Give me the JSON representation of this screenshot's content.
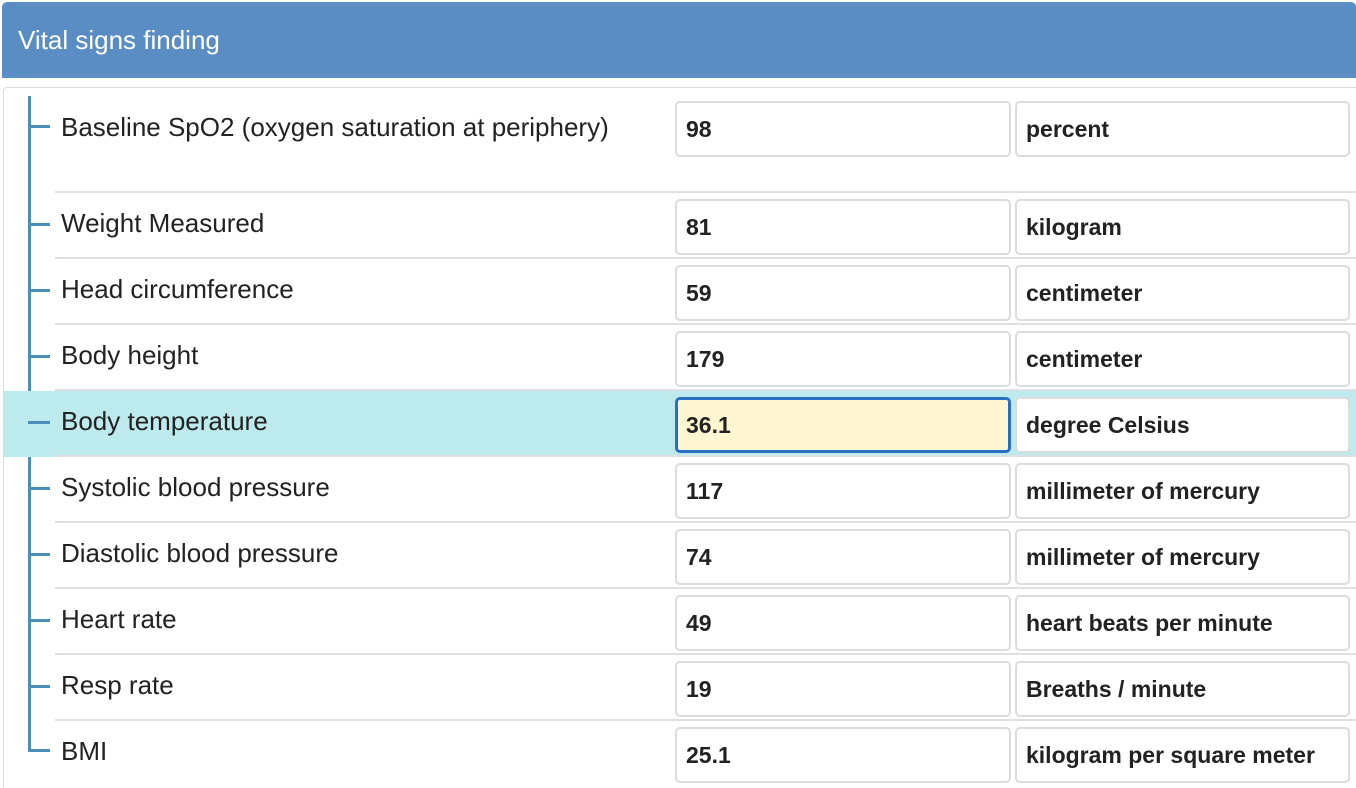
{
  "header": {
    "title": "Vital signs finding"
  },
  "rows": [
    {
      "label": "Baseline SpO2 (oxygen saturation at periphery)",
      "value": "98",
      "unit": "percent"
    },
    {
      "label": "Weight Measured",
      "value": "81",
      "unit": "kilogram"
    },
    {
      "label": "Head circumference",
      "value": "59",
      "unit": "centimeter"
    },
    {
      "label": "Body height",
      "value": "179",
      "unit": "centimeter"
    },
    {
      "label": "Body temperature",
      "value": "36.1",
      "unit": "degree Celsius"
    },
    {
      "label": "Systolic blood pressure",
      "value": "117",
      "unit": "millimeter of mercury"
    },
    {
      "label": "Diastolic blood pressure",
      "value": "74",
      "unit": "millimeter of mercury"
    },
    {
      "label": "Heart rate",
      "value": "49",
      "unit": "heart beats per minute"
    },
    {
      "label": "Resp rate",
      "value": "19",
      "unit": "Breaths / minute"
    },
    {
      "label": "BMI",
      "value": "25.1",
      "unit": "kilogram per square meter"
    }
  ],
  "colors": {
    "header_bg": "#5a8dc3",
    "highlight_row": "#bdeaec",
    "focused_field_bg": "#fdf6d1",
    "focused_field_border": "#2a6fc0",
    "tree_line": "#4a8fb8"
  },
  "state": {
    "focused_field": "Body temperature"
  }
}
